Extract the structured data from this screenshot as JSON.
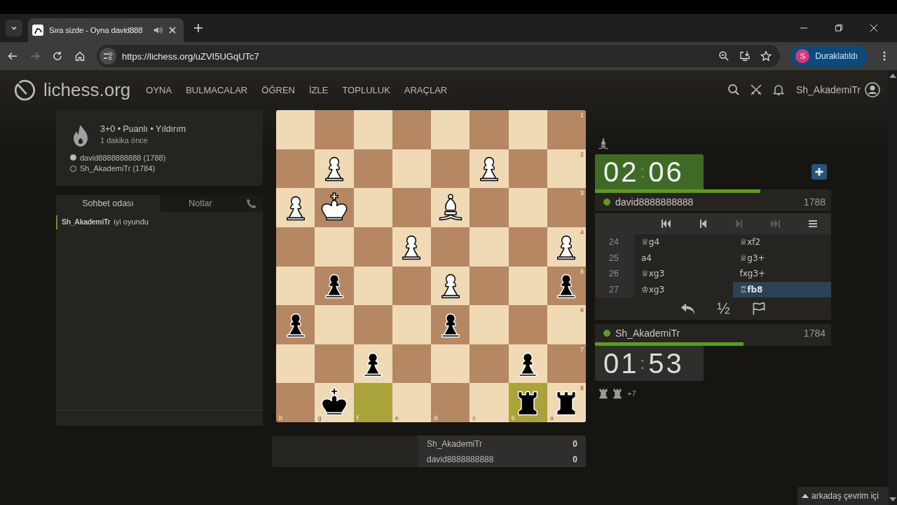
{
  "browser": {
    "tab": {
      "title": "Sıra sizde - Oyna david888",
      "audio": true
    },
    "url": "https://lichess.org/uZVI5UGqUTc7",
    "profile": {
      "initial": "S",
      "label": "Duraklatıldı"
    }
  },
  "site": {
    "logo": "lichess.org",
    "nav": [
      "OYNA",
      "BULMACALAR",
      "ÖĞREN",
      "İZLE",
      "TOPLULUK",
      "ARAÇLAR"
    ],
    "user": "Sh_AkademiTr"
  },
  "game_info": {
    "title": "3+0 • Puanlı • Yıldırım",
    "time": "1 dakika önce",
    "players": [
      {
        "name": "david8888888888 (1788)",
        "white": true
      },
      {
        "name": "Sh_AkademiTr (1784)",
        "white": false
      }
    ]
  },
  "chat": {
    "tabs": [
      {
        "label": "Sohbet odası",
        "selected": true
      },
      {
        "label": "Notlar",
        "selected": false
      }
    ],
    "messages": [
      {
        "user": "Sh_AkademiTr",
        "text": "iyi oyundu"
      }
    ]
  },
  "board": {
    "files": [
      "h",
      "g",
      "f",
      "e",
      "d",
      "c",
      "b",
      "a"
    ],
    "rows": [
      {
        "rank": "1",
        "squares": [
          {
            "highlighted": false
          },
          {
            "highlighted": false
          },
          {
            "highlighted": false
          },
          {
            "highlighted": false
          },
          {
            "highlighted": false
          },
          {
            "highlighted": false
          },
          {
            "highlighted": false
          },
          {
            "highlighted": false
          }
        ]
      },
      {
        "rank": "2",
        "squares": [
          {
            "highlighted": false
          },
          {
            "kind": "pawn",
            "white": true,
            "highlighted": false
          },
          {
            "highlighted": false
          },
          {
            "highlighted": false
          },
          {
            "highlighted": false
          },
          {
            "kind": "pawn",
            "white": true,
            "highlighted": false
          },
          {
            "highlighted": false
          },
          {
            "highlighted": false
          }
        ]
      },
      {
        "rank": "3",
        "squares": [
          {
            "kind": "pawn",
            "white": true,
            "highlighted": false
          },
          {
            "kind": "king",
            "white": true,
            "highlighted": false
          },
          {
            "highlighted": false
          },
          {
            "highlighted": false
          },
          {
            "kind": "bishop",
            "white": true,
            "highlighted": false
          },
          {
            "highlighted": false
          },
          {
            "highlighted": false
          },
          {
            "highlighted": false
          }
        ]
      },
      {
        "rank": "4",
        "squares": [
          {
            "highlighted": false
          },
          {
            "highlighted": false
          },
          {
            "highlighted": false
          },
          {
            "kind": "pawn",
            "white": true,
            "highlighted": false
          },
          {
            "highlighted": false
          },
          {
            "highlighted": false
          },
          {
            "highlighted": false
          },
          {
            "kind": "pawn",
            "white": true,
            "highlighted": false
          }
        ]
      },
      {
        "rank": "5",
        "squares": [
          {
            "highlighted": false
          },
          {
            "kind": "pawn",
            "white": false,
            "highlighted": false
          },
          {
            "highlighted": false
          },
          {
            "highlighted": false
          },
          {
            "kind": "pawn",
            "white": true,
            "highlighted": false
          },
          {
            "highlighted": false
          },
          {
            "highlighted": false
          },
          {
            "kind": "pawn",
            "white": false,
            "highlighted": false
          }
        ]
      },
      {
        "rank": "6",
        "squares": [
          {
            "kind": "pawn",
            "white": false,
            "highlighted": false
          },
          {
            "highlighted": false
          },
          {
            "highlighted": false
          },
          {
            "highlighted": false
          },
          {
            "kind": "pawn",
            "white": false,
            "highlighted": false
          },
          {
            "highlighted": false
          },
          {
            "highlighted": false
          },
          {
            "highlighted": false
          }
        ]
      },
      {
        "rank": "7",
        "squares": [
          {
            "highlighted": false
          },
          {
            "highlighted": false
          },
          {
            "kind": "pawn",
            "white": false,
            "highlighted": false
          },
          {
            "highlighted": false
          },
          {
            "highlighted": false
          },
          {
            "highlighted": false
          },
          {
            "kind": "pawn",
            "white": false,
            "highlighted": false
          },
          {
            "highlighted": false
          }
        ]
      },
      {
        "rank": "8",
        "squares": [
          {
            "highlighted": false
          },
          {
            "kind": "king",
            "white": false,
            "highlighted": false
          },
          {
            "highlighted": true
          },
          {
            "highlighted": false
          },
          {
            "highlighted": false
          },
          {
            "highlighted": false
          },
          {
            "kind": "rook",
            "white": false,
            "highlighted": true
          },
          {
            "kind": "rook",
            "white": false,
            "highlighted": false
          }
        ]
      }
    ]
  },
  "scores": [
    {
      "name": "Sh_AkademiTr",
      "score": "0"
    },
    {
      "name": "david8888888888",
      "score": "0"
    }
  ],
  "opponent": {
    "captured": [
      {
        "kind": "bishop"
      }
    ],
    "clock": {
      "minutes": "02",
      "separator": ":",
      "seconds": "06",
      "running": true,
      "level": 0.7
    },
    "name": "david8888888888",
    "rating": "1788",
    "online": true
  },
  "controls": [
    {
      "kind": "first",
      "disabled": false
    },
    {
      "kind": "prev",
      "disabled": false
    },
    {
      "kind": "next",
      "disabled": true
    },
    {
      "kind": "last",
      "disabled": true
    },
    {
      "kind": "menu",
      "disabled": false
    }
  ],
  "moves": [
    {
      "number": "24",
      "white": {
        "san": "♕g4",
        "selected": false
      },
      "black": {
        "san": "♕xf2",
        "selected": false
      }
    },
    {
      "number": "25",
      "white": {
        "san": "a4",
        "selected": false
      },
      "black": {
        "san": "♕g3+",
        "selected": false
      }
    },
    {
      "number": "26",
      "white": {
        "san": "♕xg3",
        "selected": false
      },
      "black": {
        "san": "fxg3+",
        "selected": false
      }
    },
    {
      "number": "27",
      "white": {
        "san": "♔xg3",
        "selected": false
      },
      "black": {
        "san": "♖fb8",
        "selected": true
      }
    }
  ],
  "draw_offer": "½",
  "player": {
    "name": "Sh_AkademiTr",
    "rating": "1784",
    "online": true,
    "clock": {
      "minutes": "01",
      "separator": ":",
      "seconds": "53",
      "running": false,
      "level": 0.63
    },
    "captured": [
      {
        "kind": "rook"
      },
      {
        "kind": "rook"
      }
    ],
    "advantage": "+7"
  },
  "friends": "arkadaş çevrim içi"
}
